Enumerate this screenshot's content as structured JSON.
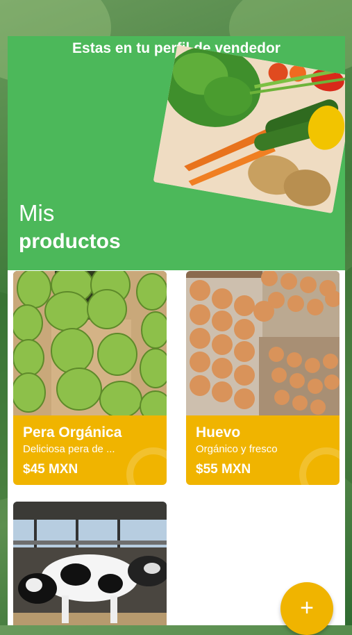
{
  "header": {
    "title": "Estas en tu perfil de vendedor"
  },
  "section": {
    "title_light": "Mis",
    "title_bold": "productos"
  },
  "products": [
    {
      "name": "Pera Orgánica",
      "description": "Deliciosa pera de ...",
      "price": "$45 MXN"
    },
    {
      "name": "Huevo",
      "description": "Orgánico y fresco",
      "price": "$55 MXN"
    },
    {
      "name": "",
      "description": "",
      "price": ""
    }
  ],
  "fab": {
    "icon": "plus-icon",
    "label": "+"
  },
  "colors": {
    "primary_green": "#4cb85a",
    "accent_yellow": "#f0b400",
    "text_on_color": "#ffffff"
  }
}
